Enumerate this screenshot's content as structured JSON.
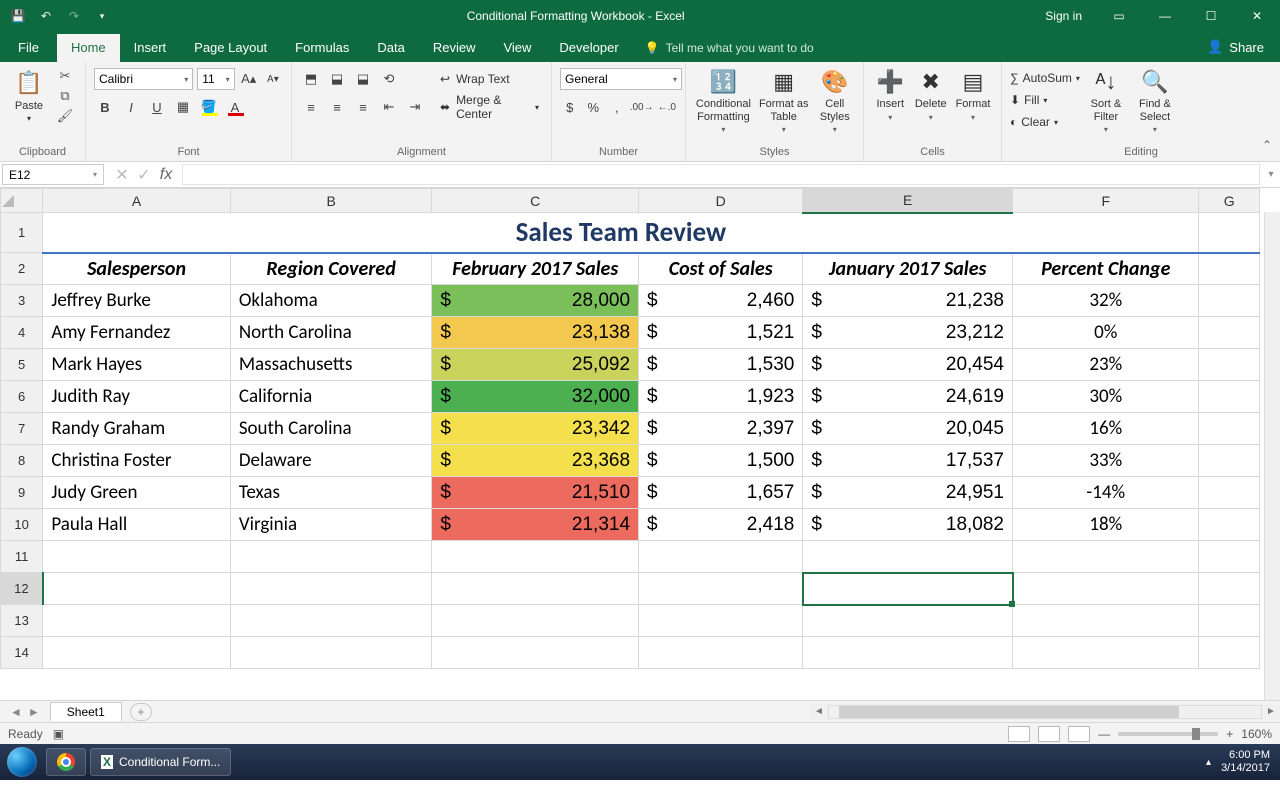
{
  "app": {
    "title": "Conditional Formatting Workbook  -  Excel",
    "signin": "Sign in"
  },
  "tabs": {
    "file": "File",
    "home": "Home",
    "insert": "Insert",
    "pagelayout": "Page Layout",
    "formulas": "Formulas",
    "data": "Data",
    "review": "Review",
    "view": "View",
    "developer": "Developer",
    "tellme": "Tell me what you want to do",
    "share": "Share"
  },
  "ribbon": {
    "clipboard": {
      "label": "Clipboard",
      "paste": "Paste"
    },
    "font": {
      "label": "Font",
      "name": "Calibri",
      "size": "11"
    },
    "alignment": {
      "label": "Alignment",
      "wrap": "Wrap Text",
      "merge": "Merge & Center"
    },
    "number": {
      "label": "Number",
      "format": "General"
    },
    "styles": {
      "label": "Styles",
      "cond": "Conditional Formatting",
      "table": "Format as Table",
      "cell": "Cell Styles"
    },
    "cells": {
      "label": "Cells",
      "insert": "Insert",
      "delete": "Delete",
      "format": "Format"
    },
    "editing": {
      "label": "Editing",
      "autosum": "AutoSum",
      "fill": "Fill",
      "clear": "Clear",
      "sort": "Sort & Filter",
      "find": "Find & Select"
    }
  },
  "formula_bar": {
    "cell_ref": "E12",
    "formula": ""
  },
  "columns": [
    "A",
    "B",
    "C",
    "D",
    "E",
    "F",
    "G"
  ],
  "rows": [
    "1",
    "2",
    "3",
    "4",
    "5",
    "6",
    "7",
    "8",
    "9",
    "10",
    "11",
    "12",
    "13",
    "14"
  ],
  "selected_cell": "E12",
  "sheet": {
    "title": "Sales Team Review",
    "headers": {
      "A": "Salesperson",
      "B": "Region Covered",
      "C": "February 2017 Sales",
      "D": "Cost of Sales",
      "E": "January 2017 Sales",
      "F": "Percent Change"
    },
    "data": [
      {
        "sp": "Jeffrey Burke",
        "rg": "Oklahoma",
        "feb": "28,000",
        "cost": "2,460",
        "jan": "21,238",
        "pct": "32%",
        "cf": "#7bbf5a"
      },
      {
        "sp": "Amy Fernandez",
        "rg": "North Carolina",
        "feb": "23,138",
        "cost": "1,521",
        "jan": "23,212",
        "pct": "0%",
        "cf": "#f3c84e"
      },
      {
        "sp": "Mark Hayes",
        "rg": "Massachusetts",
        "feb": "25,092",
        "cost": "1,530",
        "jan": "20,454",
        "pct": "23%",
        "cf": "#c9d25a"
      },
      {
        "sp": "Judith Ray",
        "rg": "California",
        "feb": "32,000",
        "cost": "1,923",
        "jan": "24,619",
        "pct": "30%",
        "cf": "#4caf50"
      },
      {
        "sp": "Randy Graham",
        "rg": "South Carolina",
        "feb": "23,342",
        "cost": "2,397",
        "jan": "20,045",
        "pct": "16%",
        "cf": "#f4e04d"
      },
      {
        "sp": "Christina Foster",
        "rg": "Delaware",
        "feb": "23,368",
        "cost": "1,500",
        "jan": "17,537",
        "pct": "33%",
        "cf": "#f4e04d"
      },
      {
        "sp": "Judy Green",
        "rg": "Texas",
        "feb": "21,510",
        "cost": "1,657",
        "jan": "24,951",
        "pct": "-14%",
        "cf": "#ec6a5e"
      },
      {
        "sp": "Paula Hall",
        "rg": "Virginia",
        "feb": "21,314",
        "cost": "2,418",
        "jan": "18,082",
        "pct": "18%",
        "cf": "#ec6a5e"
      }
    ]
  },
  "chart_data": {
    "type": "table",
    "title": "Sales Team Review",
    "columns": [
      "Salesperson",
      "Region Covered",
      "February 2017 Sales",
      "Cost of Sales",
      "January 2017 Sales",
      "Percent Change"
    ],
    "rows": [
      [
        "Jeffrey Burke",
        "Oklahoma",
        28000,
        2460,
        21238,
        0.32
      ],
      [
        "Amy Fernandez",
        "North Carolina",
        23138,
        1521,
        23212,
        0.0
      ],
      [
        "Mark Hayes",
        "Massachusetts",
        25092,
        1530,
        20454,
        0.23
      ],
      [
        "Judith Ray",
        "California",
        32000,
        1923,
        24619,
        0.3
      ],
      [
        "Randy Graham",
        "South Carolina",
        23342,
        2397,
        20045,
        0.16
      ],
      [
        "Christina Foster",
        "Delaware",
        23368,
        1500,
        17537,
        0.33
      ],
      [
        "Judy Green",
        "Texas",
        21510,
        1657,
        24951,
        -0.14
      ],
      [
        "Paula Hall",
        "Virginia",
        21314,
        2418,
        18082,
        0.18
      ]
    ]
  },
  "sheet_tabs": {
    "active": "Sheet1"
  },
  "status": {
    "ready": "Ready",
    "zoom": "160%"
  },
  "taskbar": {
    "app": "Conditional Form...",
    "time": "6:00 PM",
    "date": "3/14/2017"
  }
}
